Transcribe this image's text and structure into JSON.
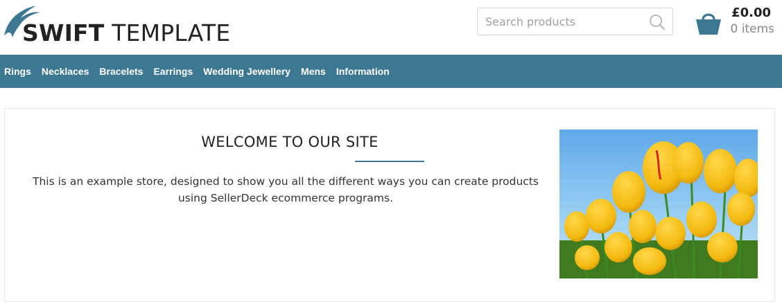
{
  "logo": {
    "brand_bold": "SWIFT",
    "brand_light": "TEMPLATE"
  },
  "search": {
    "placeholder": "Search products",
    "icon": "search-icon"
  },
  "cart": {
    "total": "£0.00",
    "items": "0 items",
    "icon": "basket-icon"
  },
  "nav": {
    "items": [
      "Rings",
      "Necklaces",
      "Bracelets",
      "Earrings",
      "Wedding Jewellery",
      "Mens",
      "Information"
    ]
  },
  "welcome": {
    "title": "WELCOME TO OUR SITE",
    "text": "This is an example store, designed to show you all the different ways you can create products using SellerDeck ecommerce programs."
  },
  "colors": {
    "accent": "#3d7893",
    "nav_text": "#ffffff"
  }
}
